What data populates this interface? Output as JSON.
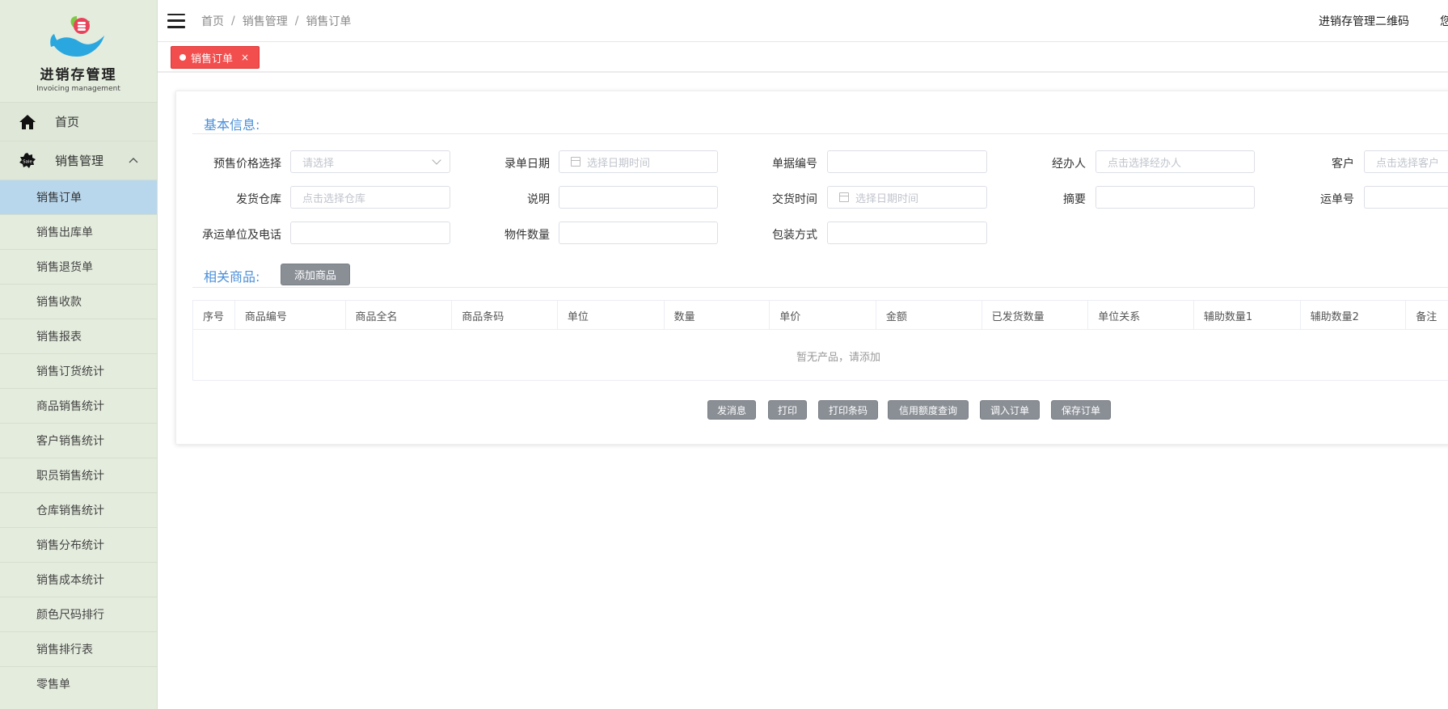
{
  "sidebar": {
    "logo": {
      "title": "进销存管理",
      "subtitle": "Invoicing management"
    },
    "home": {
      "label": "首页",
      "icon": "home-icon"
    },
    "group": {
      "label": "销售管理",
      "icon": "sale-badge-icon",
      "expanded": true
    },
    "items": [
      {
        "label": "销售订单",
        "active": true
      },
      {
        "label": "销售出库单"
      },
      {
        "label": "销售退货单"
      },
      {
        "label": "销售收款"
      },
      {
        "label": "销售报表"
      },
      {
        "label": "销售订货统计"
      },
      {
        "label": "商品销售统计"
      },
      {
        "label": "客户销售统计"
      },
      {
        "label": "职员销售统计"
      },
      {
        "label": "仓库销售统计"
      },
      {
        "label": "销售分布统计"
      },
      {
        "label": "销售成本统计"
      },
      {
        "label": "颜色尺码排行"
      },
      {
        "label": "销售排行表"
      },
      {
        "label": "零售单"
      }
    ]
  },
  "header": {
    "breadcrumb": [
      "首页",
      "销售管理",
      "销售订单"
    ],
    "separator": "/",
    "qr_link": "进销存管理二维码",
    "user_partial": "您"
  },
  "tabs": [
    {
      "label": "销售订单",
      "close": "×"
    }
  ],
  "form": {
    "basic_title": "基本信息:",
    "fields": {
      "price_select": {
        "label": "预售价格选择",
        "placeholder": "请选择"
      },
      "entry_date": {
        "label": "录单日期",
        "placeholder": "选择日期时间"
      },
      "doc_no": {
        "label": "单据编号",
        "placeholder": ""
      },
      "handler": {
        "label": "经办人",
        "placeholder": "点击选择经办人"
      },
      "customer": {
        "label": "客户",
        "placeholder": "点击选择客户"
      },
      "warehouse": {
        "label": "发货仓库",
        "placeholder": "点击选择仓库"
      },
      "note": {
        "label": "说明",
        "placeholder": ""
      },
      "delivery_time": {
        "label": "交货时间",
        "placeholder": "选择日期时间"
      },
      "summary": {
        "label": "摘要",
        "placeholder": ""
      },
      "waybill": {
        "label": "运单号",
        "placeholder": ""
      },
      "carrier": {
        "label": "承运单位及电话",
        "placeholder": ""
      },
      "piece_count": {
        "label": "物件数量",
        "placeholder": ""
      },
      "packing": {
        "label": "包装方式",
        "placeholder": ""
      }
    },
    "products_title": "相关商品:",
    "add_product": "添加商品"
  },
  "table": {
    "columns": [
      "序号",
      "商品编号",
      "商品全名",
      "商品条码",
      "单位",
      "数量",
      "单价",
      "金额",
      "已发货数量",
      "单位关系",
      "辅助数量1",
      "辅助数量2",
      "备注"
    ],
    "empty_text": "暂无产品，请添加"
  },
  "actions": [
    "发消息",
    "打印",
    "打印条码",
    "信用额度查询",
    "调入订单",
    "保存订单"
  ],
  "colors": {
    "accent": "#4a8fd8",
    "tab_active": "#f24e4e",
    "sidebar_bg": "#e4ecdd",
    "sidebar_active": "#b8d7ec"
  }
}
